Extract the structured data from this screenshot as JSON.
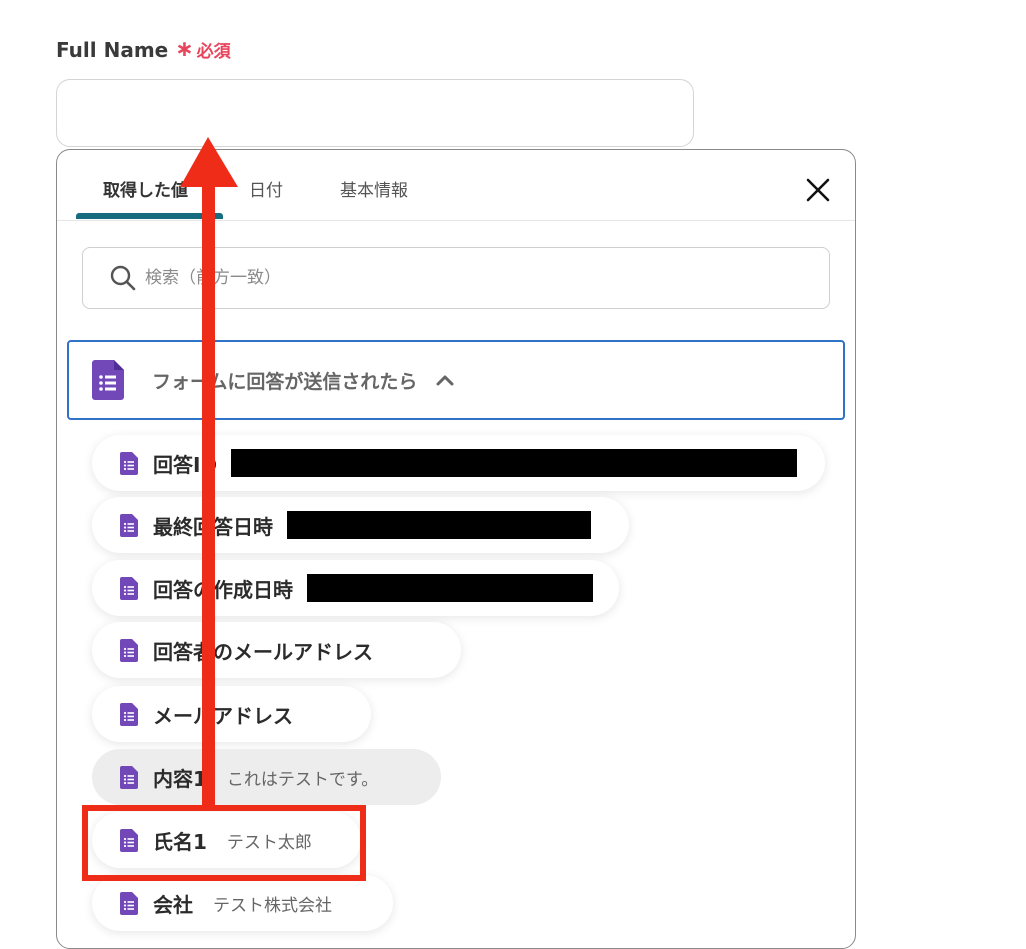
{
  "field": {
    "label": "Full Name",
    "required_star": "∗",
    "required_text": "必須",
    "value": ""
  },
  "panel": {
    "tabs": [
      {
        "label": "取得した値",
        "active": true
      },
      {
        "label": "日付",
        "active": false
      },
      {
        "label": "基本情報",
        "active": false
      }
    ],
    "search_placeholder": "検索（前方一致）",
    "group": {
      "label": "フォームに回答が送信されたら",
      "icon": "google-forms-icon",
      "expanded": true
    },
    "items": [
      {
        "label": "回答ID",
        "value": "",
        "redacted": true
      },
      {
        "label": "最終回答日時",
        "value": "",
        "redacted": true
      },
      {
        "label": "回答の作成日時",
        "value": "",
        "redacted": true
      },
      {
        "label": "回答者のメールアドレス",
        "value": ""
      },
      {
        "label": "メールアドレス",
        "value": ""
      },
      {
        "label": "内容1",
        "value": "これはテストです。",
        "hovered": true
      },
      {
        "label": "氏名1",
        "value": "テスト太郎",
        "highlighted": true
      },
      {
        "label": "会社",
        "value": "テスト株式会社"
      }
    ]
  },
  "colors": {
    "accent_tab": "#176c80",
    "group_border": "#2f73c9",
    "required": "#e8455c",
    "forms_icon": "#7248b9",
    "annotation": "#ee2c18"
  }
}
